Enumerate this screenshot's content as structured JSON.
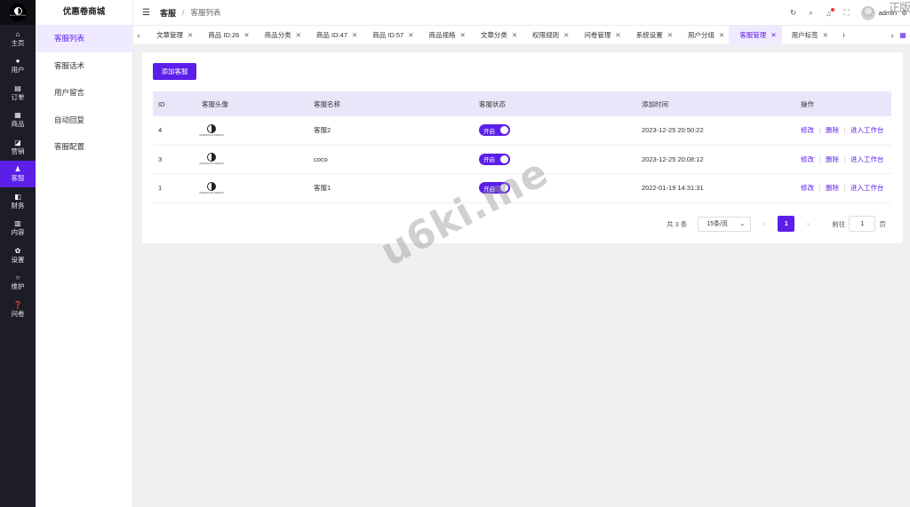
{
  "app": {
    "brand": "优惠卷商城",
    "logo_text": "AMERICAN DREAM"
  },
  "rail": {
    "items": [
      {
        "label": "主页",
        "icon": "home-icon",
        "glyph": "⌂"
      },
      {
        "label": "用户",
        "icon": "user-icon",
        "glyph": "●"
      },
      {
        "label": "订单",
        "icon": "order-icon",
        "glyph": "▤"
      },
      {
        "label": "商品",
        "icon": "goods-icon",
        "glyph": "▦"
      },
      {
        "label": "营销",
        "icon": "marketing-icon",
        "glyph": "◪"
      },
      {
        "label": "客服",
        "icon": "service-icon",
        "glyph": "♟"
      },
      {
        "label": "财务",
        "icon": "finance-icon",
        "glyph": "◧"
      },
      {
        "label": "内容",
        "icon": "content-icon",
        "glyph": "▥"
      },
      {
        "label": "设置",
        "icon": "settings-icon",
        "glyph": "✿"
      },
      {
        "label": "维护",
        "icon": "maintain-icon",
        "glyph": "○"
      },
      {
        "label": "问卷",
        "icon": "survey-icon",
        "glyph": "❓"
      }
    ],
    "active_index": 5
  },
  "submenu": {
    "items": [
      "客服列表",
      "客服话术",
      "用户留言",
      "自动回复",
      "客服配置"
    ],
    "active_index": 0
  },
  "header": {
    "breadcrumb_root": "客服",
    "breadcrumb_separator": "/",
    "breadcrumb_current": "客服列表",
    "username": "admin",
    "corner_text": "正版"
  },
  "tabs": [
    {
      "label": "文章管理",
      "active": false
    },
    {
      "label": "商品 ID:26",
      "active": false
    },
    {
      "label": "商品分类",
      "active": false
    },
    {
      "label": "商品 ID:47",
      "active": false
    },
    {
      "label": "商品 ID:57",
      "active": false
    },
    {
      "label": "商品规格",
      "active": false
    },
    {
      "label": "文章分类",
      "active": false
    },
    {
      "label": "权限规则",
      "active": false
    },
    {
      "label": "问卷管理",
      "active": false
    },
    {
      "label": "系统设置",
      "active": false
    },
    {
      "label": "用户分组",
      "active": false
    },
    {
      "label": "客服管理",
      "active": true
    },
    {
      "label": "用户标签",
      "active": false
    },
    {
      "label": "i",
      "active": false
    }
  ],
  "toolbar": {
    "add_label": "添加客服"
  },
  "table": {
    "columns": [
      "ID",
      "客服头像",
      "客服名称",
      "客服状态",
      "添加时间",
      "操作"
    ],
    "rows": [
      {
        "id": "4",
        "name": "客服2",
        "status": "开启",
        "time": "2023-12-25 20:50:22"
      },
      {
        "id": "3",
        "name": "coco",
        "status": "开启",
        "time": "2023-12-25 20:08:12"
      },
      {
        "id": "1",
        "name": "客服1",
        "status": "开启",
        "time": "2022-01-19 14:31:31"
      }
    ],
    "ops": {
      "edit": "修改",
      "delete": "删除",
      "workbench": "进入工作台"
    }
  },
  "pagination": {
    "total_text": "共 3 条",
    "page_size": "15条/页",
    "current_page": "1",
    "goto_label": "前往",
    "goto_value": "1",
    "page_suffix": "页"
  },
  "watermark": "u6ki.me",
  "colors": {
    "accent": "#5b1fe8",
    "rail_bg": "#1c1d26",
    "active_tint": "#efeaff"
  }
}
